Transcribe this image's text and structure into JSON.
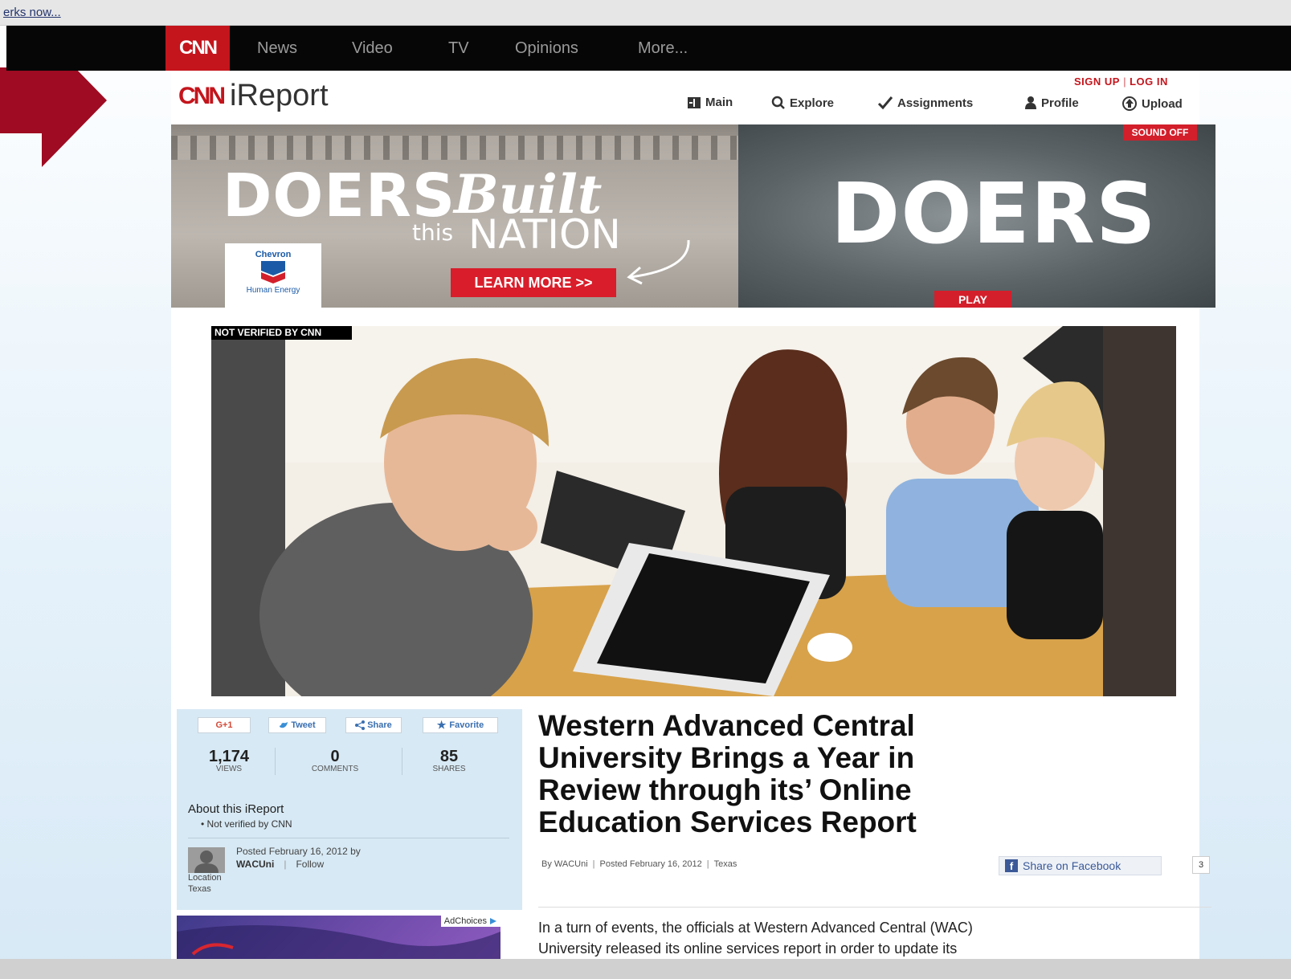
{
  "browser": {
    "top_link": "erks now..."
  },
  "cnn_nav": {
    "logo": "CNN",
    "items": [
      "News",
      "Video",
      "TV",
      "Opinions",
      "More..."
    ]
  },
  "ireport": {
    "logo_mark": "CNN",
    "logo_text": "iReport",
    "auth": {
      "signup": "SIGN UP",
      "login": "LOG IN"
    },
    "subnav": [
      {
        "label": "Main",
        "icon": "main-icon"
      },
      {
        "label": "Explore",
        "icon": "search-icon"
      },
      {
        "label": "Assignments",
        "icon": "checkmark-icon"
      },
      {
        "label": "Profile",
        "icon": "person-icon"
      },
      {
        "label": "Upload",
        "icon": "upload-icon"
      }
    ]
  },
  "ad_banner": {
    "headline_1": "DOERS",
    "headline_2": "Built",
    "headline_3": "this",
    "headline_4": "NATION",
    "cta": "LEARN MORE  >>",
    "brand": "Chevron",
    "brand_tagline": "Human Energy",
    "headline_right": "DOERS",
    "sound": "SOUND  OFF",
    "play": "PLAY"
  },
  "photo": {
    "badge": "NOT VERIFIED BY CNN"
  },
  "social": {
    "buttons": [
      "G+1",
      "Tweet",
      "Share",
      "Favorite"
    ],
    "stats": [
      {
        "value": "1,174",
        "label": "VIEWS"
      },
      {
        "value": "0",
        "label": "COMMENTS"
      },
      {
        "value": "85",
        "label": "SHARES"
      }
    ],
    "about_title": "About this iReport",
    "about_item": "• Not verified by CNN",
    "posted": "Posted February 16, 2012 by",
    "user": "WACUni",
    "follow": "Follow",
    "location_label": "Location",
    "location_value": "Texas"
  },
  "ad2": {
    "adchoices": "AdChoices"
  },
  "article": {
    "title_lines": [
      "Western Advanced Central",
      "University Brings a Year in",
      "Review through its’ Online",
      "Education Services Report"
    ],
    "byline": {
      "author": "By WACUni",
      "date": "Posted February 16, 2012",
      "location": "Texas"
    },
    "fb_share": "Share on Facebook",
    "fb_count": "3",
    "body_lines": [
      "In a turn of events, the officials at Western Advanced Central (WAC)",
      "University released its online services report in order to update its"
    ]
  },
  "colors": {
    "cnn_red": "#c4151c",
    "nav_bg": "#060606",
    "arrow": "#9e0b22",
    "panel_bg": "#d7e9f4"
  }
}
